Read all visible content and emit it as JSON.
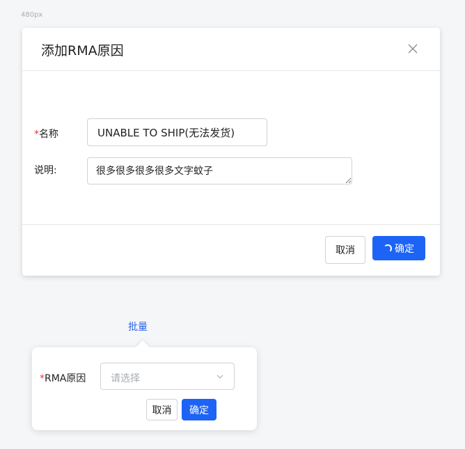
{
  "canvas": {
    "size_label": "480px"
  },
  "dialog": {
    "title": "添加RMA原因",
    "fields": {
      "name": {
        "required_mark": "*",
        "label": "名称",
        "value": "UNABLE TO SHIP(无法发货)"
      },
      "description": {
        "label": "说明:",
        "value": "很多很多很多很多文字蚊子"
      }
    },
    "footer": {
      "cancel_label": "取消",
      "ok_label": "确定",
      "ok_loading": true
    }
  },
  "batch": {
    "link_label": "批量",
    "popover": {
      "required_mark": "*",
      "label": "RMA原因",
      "select_placeholder": "请选择",
      "cancel_label": "取消",
      "ok_label": "确定"
    }
  },
  "colors": {
    "primary": "#1d63f5",
    "required": "#e0393e",
    "link": "#2b62e8"
  },
  "icons": {
    "close": "close-icon",
    "dropdown": "chevron-down-icon",
    "loading": "spinner-icon"
  }
}
